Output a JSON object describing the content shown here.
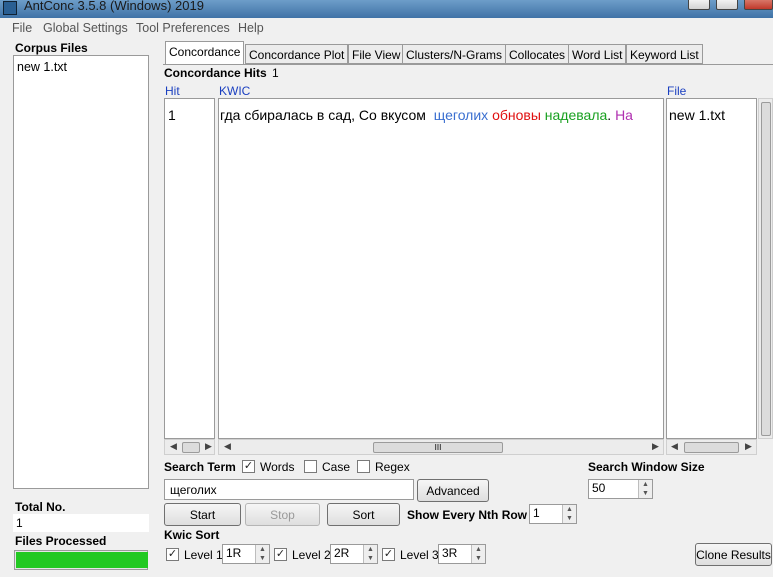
{
  "window": {
    "title": "AntConc 3.5.8 (Windows) 2019"
  },
  "menu": [
    "File",
    "Global Settings",
    "Tool Preferences",
    "Help"
  ],
  "corpus": {
    "header": "Corpus Files",
    "files": [
      "new  1.txt"
    ],
    "total_label": "Total No.",
    "total_value": "1",
    "processed_label": "Files Processed",
    "progress": 1.0
  },
  "tabs": [
    "Concordance",
    "Concordance Plot",
    "File View",
    "Clusters/N-Grams",
    "Collocates",
    "Word List",
    "Keyword List"
  ],
  "concordance": {
    "hits_label": "Concordance Hits",
    "hits_value": "1",
    "col_hit": "Hit",
    "col_kwic": "KWIC",
    "col_file": "File",
    "rows": [
      {
        "hit": "1",
        "left": "гда сбиралась в сад, Со вкусом",
        "keyword": "щеголих",
        "r1": "обновы",
        "r2": "надевала",
        "r2_punct": ".",
        "r3": "На",
        "file": "new  1.txt"
      }
    ],
    "scroll_mark": "III"
  },
  "search": {
    "label": "Search Term",
    "words_label": "Words",
    "words_checked": true,
    "case_label": "Case",
    "case_checked": false,
    "regex_label": "Regex",
    "regex_checked": false,
    "term": "щеголих",
    "advanced_label": "Advanced",
    "window_size_label": "Search Window Size",
    "window_size": "50"
  },
  "actions": {
    "start": "Start",
    "stop": "Stop",
    "sort": "Sort",
    "nth_row_label": "Show Every Nth Row",
    "nth_row": "1"
  },
  "kwic_sort": {
    "label": "Kwic Sort",
    "levels": [
      {
        "label": "Level 1",
        "value": "1R",
        "checked": true
      },
      {
        "label": "Level 2",
        "value": "2R",
        "checked": true
      },
      {
        "label": "Level 3",
        "value": "3R",
        "checked": true
      }
    ],
    "clone_label": "Clone Results"
  },
  "colors": {
    "keyword": "#3a6fd0",
    "r1": "#e01010",
    "r2": "#19a020",
    "r3": "#b030b0",
    "progress": "#22c922",
    "column_header": "#1a3fc0"
  }
}
